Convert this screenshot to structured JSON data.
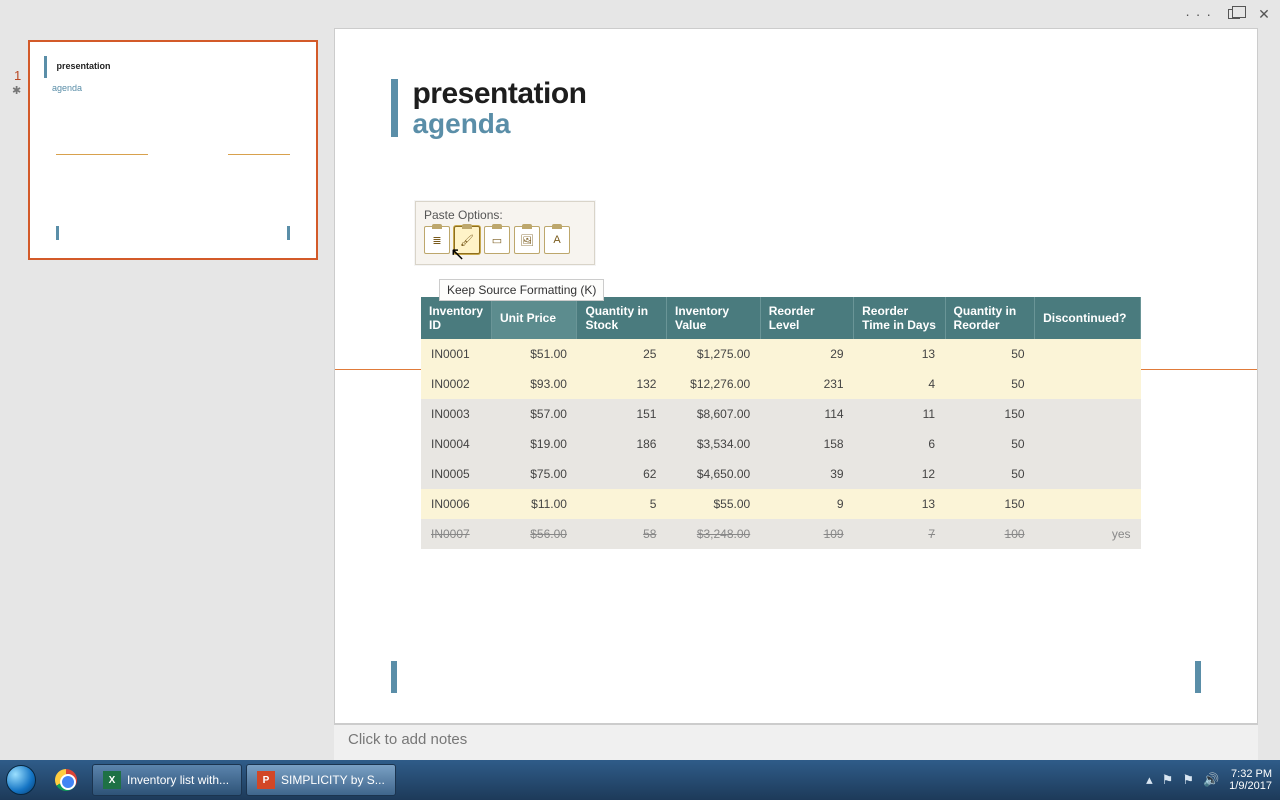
{
  "window": {
    "ellipsis": "·  ·  ·"
  },
  "thumb": {
    "slide_number": "1",
    "title": "presentation",
    "subtitle": "agenda"
  },
  "slide": {
    "title": "presentation",
    "subtitle": "agenda"
  },
  "paste": {
    "label": "Paste Options:",
    "tooltip": "Keep Source Formatting (K)",
    "icons": {
      "dest_theme": "≣",
      "keep_source": "🖌",
      "embed": "▭",
      "picture": "🖼",
      "text_only": "A"
    }
  },
  "table": {
    "headers": [
      "Inventory ID",
      "Unit Price",
      "Quantity in Stock",
      "Inventory Value",
      "Reorder Level",
      "Reorder Time in Days",
      "Quantity in Reorder",
      "Discontinued?"
    ],
    "rows": [
      {
        "id": "IN0001",
        "price": "$51.00",
        "qty": "25",
        "value": "$1,275.00",
        "reorder": "29",
        "days": "13",
        "qreorder": "50",
        "disc": "",
        "cls": "a"
      },
      {
        "id": "IN0002",
        "price": "$93.00",
        "qty": "132",
        "value": "$12,276.00",
        "reorder": "231",
        "days": "4",
        "qreorder": "50",
        "disc": "",
        "cls": "a"
      },
      {
        "id": "IN0003",
        "price": "$57.00",
        "qty": "151",
        "value": "$8,607.00",
        "reorder": "114",
        "days": "11",
        "qreorder": "150",
        "disc": "",
        "cls": "b"
      },
      {
        "id": "IN0004",
        "price": "$19.00",
        "qty": "186",
        "value": "$3,534.00",
        "reorder": "158",
        "days": "6",
        "qreorder": "50",
        "disc": "",
        "cls": "b"
      },
      {
        "id": "IN0005",
        "price": "$75.00",
        "qty": "62",
        "value": "$4,650.00",
        "reorder": "39",
        "days": "12",
        "qreorder": "50",
        "disc": "",
        "cls": "b"
      },
      {
        "id": "IN0006",
        "price": "$11.00",
        "qty": "5",
        "value": "$55.00",
        "reorder": "9",
        "days": "13",
        "qreorder": "150",
        "disc": "",
        "cls": "a"
      },
      {
        "id": "IN0007",
        "price": "$56.00",
        "qty": "58",
        "value": "$3,248.00",
        "reorder": "109",
        "days": "7",
        "qreorder": "100",
        "disc": "yes",
        "cls": "b strike"
      }
    ]
  },
  "notes": {
    "placeholder": "Click to add notes"
  },
  "taskbar": {
    "excel_label": "Inventory list with...",
    "ppt_label": "SIMPLICITY by S...",
    "time": "7:32 PM",
    "date": "1/9/2017"
  }
}
